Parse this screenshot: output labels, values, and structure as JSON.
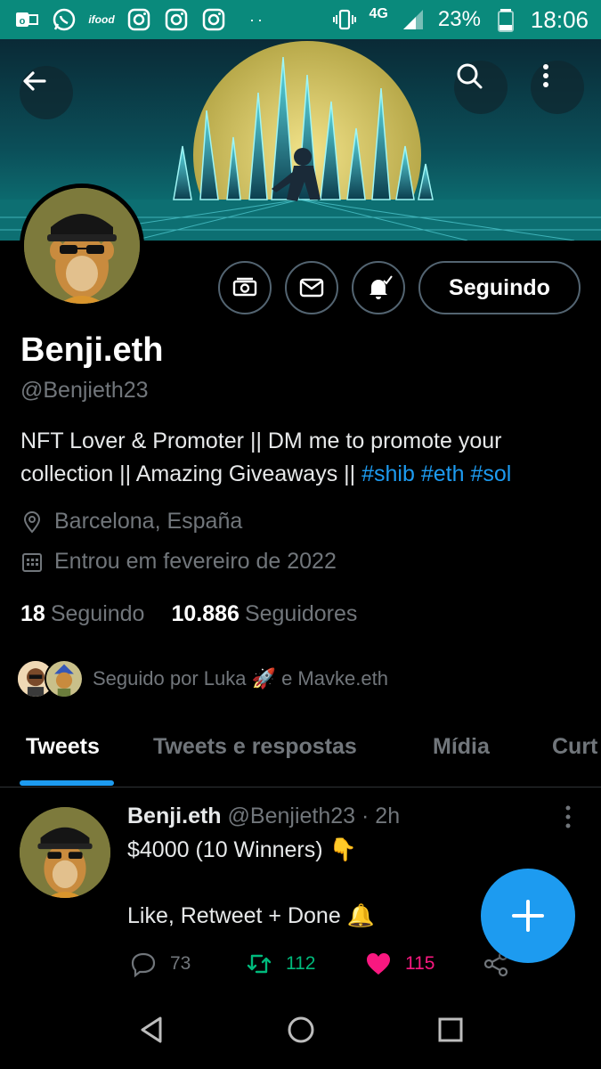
{
  "status_bar": {
    "network": "4G",
    "battery": "23%",
    "time": "18:06",
    "ifood_label": "ifood",
    "more_dots": "··",
    "icons": [
      "outlook-icon",
      "whatsapp-icon",
      "ifood-icon",
      "instagram-icon",
      "instagram-icon",
      "instagram-icon",
      "vibrate-icon",
      "signal-icon",
      "battery-icon"
    ]
  },
  "header": {
    "back_icon": "arrow-left-icon",
    "search_icon": "search-icon",
    "more_icon": "more-vertical-icon"
  },
  "profile": {
    "name": "Benji.eth",
    "handle": "@Benjieth23",
    "bio_text": "NFT Lover & Promoter || DM me to promote your collection || Amazing Giveaways || ",
    "bio_hashtags": [
      "#shib",
      "#eth",
      "#sol"
    ],
    "location": "Barcelona, España",
    "joined": "Entrou em fevereiro de 2022",
    "following_count": "18",
    "following_label": "Seguindo",
    "followers_count": "10.886",
    "followers_label": "Seguidores",
    "followed_by": "Seguido por Luka 🚀 e Mavke.eth",
    "follow_button": "Seguindo",
    "action_icons": [
      "tip-jar-icon",
      "mail-icon",
      "notification-bell-icon"
    ]
  },
  "tabs": [
    {
      "label": "Tweets",
      "active": true
    },
    {
      "label": "Tweets e respostas",
      "active": false
    },
    {
      "label": "Mídia",
      "active": false
    },
    {
      "label": "Curt",
      "active": false
    }
  ],
  "tweet": {
    "name": "Benji.eth",
    "handle": "@Benjieth23",
    "separator": "·",
    "time": "2h",
    "line1": "$4000 (10 Winners) 👇",
    "line2": "Like, Retweet + Done 🔔",
    "replies": "73",
    "retweets": "112",
    "likes": "115"
  },
  "colors": {
    "accent": "#1d9bf0",
    "retweet_green": "#00ba7c",
    "like_pink": "#f91880",
    "status_bar": "#0a8a7c",
    "muted_text": "#71767b"
  }
}
